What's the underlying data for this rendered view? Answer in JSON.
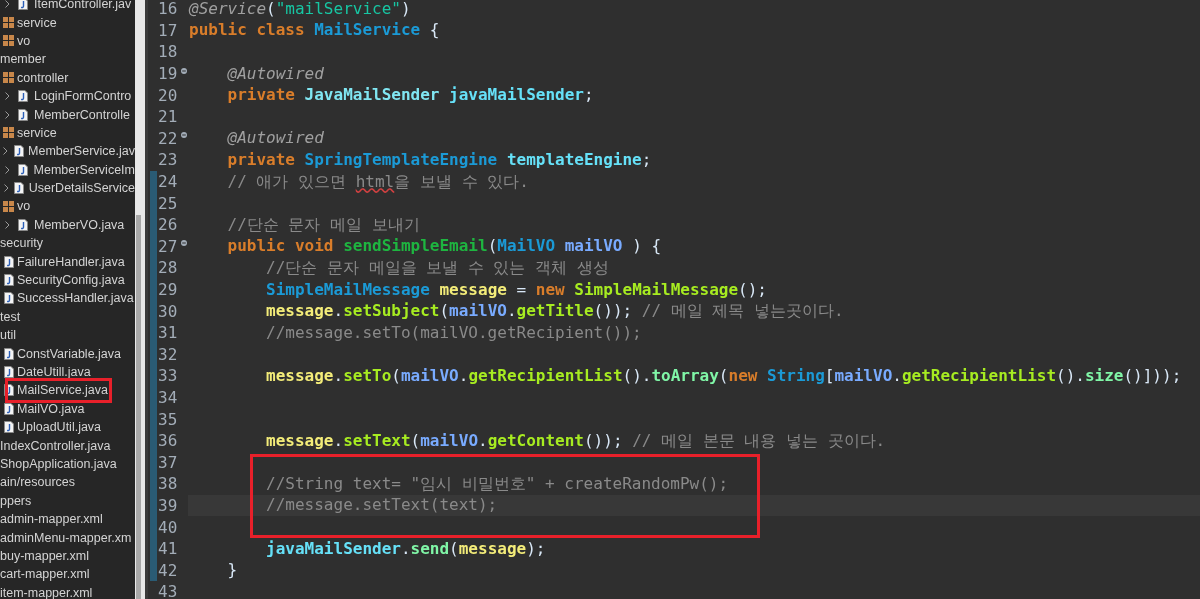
{
  "project_tree": {
    "items": [
      {
        "kind": "file",
        "text": "ItemController.jav",
        "highlighted": false
      },
      {
        "kind": "package",
        "text": "service",
        "highlighted": false
      },
      {
        "kind": "package",
        "text": "vo",
        "highlighted": false
      },
      {
        "kind": "folder",
        "text": "member",
        "highlighted": false
      },
      {
        "kind": "package",
        "text": "controller",
        "highlighted": false
      },
      {
        "kind": "file",
        "text": "LoginFormContro",
        "highlighted": false
      },
      {
        "kind": "file",
        "text": "MemberControlle",
        "highlighted": false
      },
      {
        "kind": "package",
        "text": "service",
        "highlighted": false
      },
      {
        "kind": "file",
        "text": "MemberService.jav",
        "highlighted": false
      },
      {
        "kind": "file",
        "text": "MemberServiceIm",
        "highlighted": false
      },
      {
        "kind": "file",
        "text": "UserDetailsService",
        "highlighted": false
      },
      {
        "kind": "package",
        "text": "vo",
        "highlighted": false
      },
      {
        "kind": "file",
        "text": "MemberVO.java",
        "highlighted": false
      },
      {
        "kind": "folder",
        "text": "security",
        "highlighted": false
      },
      {
        "kind": "file-plain",
        "text": "FailureHandler.java",
        "highlighted": false
      },
      {
        "kind": "file-plain",
        "text": "SecurityConfig.java",
        "highlighted": false
      },
      {
        "kind": "file-plain",
        "text": "SuccessHandler.java",
        "highlighted": false
      },
      {
        "kind": "folder",
        "text": "test",
        "highlighted": false
      },
      {
        "kind": "folder",
        "text": "util",
        "highlighted": false
      },
      {
        "kind": "file-plain",
        "text": "ConstVariable.java",
        "highlighted": false
      },
      {
        "kind": "file-plain",
        "text": "DateUtill.java",
        "highlighted": false
      },
      {
        "kind": "file-plain",
        "text": "MailService.java",
        "highlighted": true
      },
      {
        "kind": "file-plain",
        "text": "MailVO.java",
        "highlighted": false
      },
      {
        "kind": "file-plain",
        "text": "UploadUtil.java",
        "highlighted": false
      },
      {
        "kind": "folder",
        "text": "IndexController.java",
        "highlighted": false
      },
      {
        "kind": "folder",
        "text": "ShopApplication.java",
        "highlighted": false
      },
      {
        "kind": "folder",
        "text": "ain/resources",
        "highlighted": false
      },
      {
        "kind": "folder",
        "text": "ppers",
        "highlighted": false
      },
      {
        "kind": "folder",
        "text": "admin-mapper.xml",
        "highlighted": false
      },
      {
        "kind": "folder",
        "text": "adminMenu-mapper.xm",
        "highlighted": false
      },
      {
        "kind": "folder",
        "text": "buy-mapper.xml",
        "highlighted": false
      },
      {
        "kind": "folder",
        "text": "cart-mapper.xml",
        "highlighted": false
      },
      {
        "kind": "folder",
        "text": "item-mapper.xml",
        "highlighted": false
      }
    ]
  },
  "editor": {
    "lines": [
      {
        "number": "16",
        "foldable": false,
        "changed": false,
        "current": false,
        "boxed": false,
        "tokens": [
          {
            "kind": "ann",
            "text": "@Service"
          },
          {
            "kind": "plain",
            "text": "("
          },
          {
            "kind": "str",
            "text": "\"mailService\""
          },
          {
            "kind": "plain",
            "text": ")"
          }
        ]
      },
      {
        "number": "17",
        "foldable": false,
        "changed": false,
        "current": false,
        "boxed": false,
        "tokens": [
          {
            "kind": "kw",
            "text": "public class "
          },
          {
            "kind": "type",
            "text": "MailService"
          },
          {
            "kind": "plain",
            "text": " {"
          }
        ]
      },
      {
        "number": "18",
        "foldable": false,
        "changed": false,
        "current": false,
        "boxed": false
      },
      {
        "number": "19",
        "foldable": true,
        "changed": false,
        "current": false,
        "boxed": false,
        "tokens": [
          {
            "kind": "ann",
            "text": "    @Autowired"
          }
        ]
      },
      {
        "number": "20",
        "foldable": false,
        "changed": false,
        "current": false,
        "boxed": false,
        "tokens": [
          {
            "kind": "kw",
            "text": "    private "
          },
          {
            "kind": "iface",
            "text": "JavaMailSender"
          },
          {
            "kind": "field",
            "text": " javaMailSender"
          },
          {
            "kind": "plain",
            "text": ";"
          }
        ]
      },
      {
        "number": "21",
        "foldable": false,
        "changed": false,
        "current": false,
        "boxed": false
      },
      {
        "number": "22",
        "foldable": true,
        "changed": false,
        "current": false,
        "boxed": false,
        "tokens": [
          {
            "kind": "ann",
            "text": "    @Autowired"
          }
        ]
      },
      {
        "number": "23",
        "foldable": false,
        "changed": false,
        "current": false,
        "boxed": false,
        "tokens": [
          {
            "kind": "kw",
            "text": "    private "
          },
          {
            "kind": "type",
            "text": "SpringTemplateEngine"
          },
          {
            "kind": "field",
            "text": " templateEngine"
          },
          {
            "kind": "plain",
            "text": ";"
          }
        ]
      },
      {
        "number": "24",
        "foldable": false,
        "changed": true,
        "current": false,
        "boxed": false,
        "tokens": [
          {
            "kind": "cmt",
            "text": "    // 애가 있으면 "
          },
          {
            "kind": "typo",
            "text": "html"
          },
          {
            "kind": "cmt",
            "text": "을 보낼 수 있다."
          }
        ]
      },
      {
        "number": "25",
        "foldable": false,
        "changed": true,
        "current": false,
        "boxed": false
      },
      {
        "number": "26",
        "foldable": false,
        "changed": true,
        "current": false,
        "boxed": false,
        "tokens": [
          {
            "kind": "cmt",
            "text": "    //단순 문자 메일 보내기"
          }
        ]
      },
      {
        "number": "27",
        "foldable": true,
        "changed": true,
        "current": false,
        "boxed": false,
        "tokens": [
          {
            "kind": "kw",
            "text": "    public void "
          },
          {
            "kind": "decl",
            "text": "sendSimpleEmail"
          },
          {
            "kind": "plain",
            "text": "("
          },
          {
            "kind": "type",
            "text": "MailVO"
          },
          {
            "kind": "param",
            "text": " mailVO"
          },
          {
            "kind": "plain",
            "text": " ) {"
          }
        ]
      },
      {
        "number": "28",
        "foldable": false,
        "changed": true,
        "current": false,
        "boxed": false,
        "tokens": [
          {
            "kind": "cmt",
            "text": "        //단순 문자 메일을 보낼 수 있는 객체 생성"
          }
        ]
      },
      {
        "number": "29",
        "foldable": false,
        "changed": true,
        "current": false,
        "boxed": false,
        "tokens": [
          {
            "kind": "type",
            "text": "        SimpleMailMessage"
          },
          {
            "kind": "local",
            "text": " message"
          },
          {
            "kind": "plain",
            "text": " = "
          },
          {
            "kind": "kw",
            "text": "new "
          },
          {
            "kind": "call",
            "text": "SimpleMailMessage"
          },
          {
            "kind": "plain",
            "text": "();"
          }
        ]
      },
      {
        "number": "30",
        "foldable": false,
        "changed": true,
        "current": false,
        "boxed": false,
        "tokens": [
          {
            "kind": "local",
            "text": "        message"
          },
          {
            "kind": "plain",
            "text": "."
          },
          {
            "kind": "call",
            "text": "setSubject"
          },
          {
            "kind": "plain",
            "text": "("
          },
          {
            "kind": "param",
            "text": "mailVO"
          },
          {
            "kind": "plain",
            "text": "."
          },
          {
            "kind": "call",
            "text": "getTitle"
          },
          {
            "kind": "plain",
            "text": "()); "
          },
          {
            "kind": "cmt",
            "text": "// 메일 제목 넣는곳이다."
          }
        ]
      },
      {
        "number": "31",
        "foldable": false,
        "changed": true,
        "current": false,
        "boxed": false,
        "tokens": [
          {
            "kind": "cmt",
            "text": "        //message.setTo(mailVO.getRecipient());"
          }
        ]
      },
      {
        "number": "32",
        "foldable": false,
        "changed": true,
        "current": false,
        "boxed": false
      },
      {
        "number": "33",
        "foldable": false,
        "changed": true,
        "current": false,
        "boxed": false,
        "tokens": [
          {
            "kind": "local",
            "text": "        message"
          },
          {
            "kind": "plain",
            "text": "."
          },
          {
            "kind": "call",
            "text": "setTo"
          },
          {
            "kind": "plain",
            "text": "("
          },
          {
            "kind": "param",
            "text": "mailVO"
          },
          {
            "kind": "plain",
            "text": "."
          },
          {
            "kind": "call",
            "text": "getRecipientList"
          },
          {
            "kind": "plain",
            "text": "()."
          },
          {
            "kind": "call2",
            "text": "toArray"
          },
          {
            "kind": "plain",
            "text": "("
          },
          {
            "kind": "kw",
            "text": "new "
          },
          {
            "kind": "type",
            "text": "String"
          },
          {
            "kind": "plain",
            "text": "["
          },
          {
            "kind": "param",
            "text": "mailVO"
          },
          {
            "kind": "plain",
            "text": "."
          },
          {
            "kind": "call",
            "text": "getRecipientList"
          },
          {
            "kind": "plain",
            "text": "()."
          },
          {
            "kind": "call2",
            "text": "size"
          },
          {
            "kind": "plain",
            "text": "()]));"
          }
        ]
      },
      {
        "number": "34",
        "foldable": false,
        "changed": true,
        "current": false,
        "boxed": false
      },
      {
        "number": "35",
        "foldable": false,
        "changed": true,
        "current": false,
        "boxed": false
      },
      {
        "number": "36",
        "foldable": false,
        "changed": true,
        "current": false,
        "boxed": false,
        "tokens": [
          {
            "kind": "local",
            "text": "        message"
          },
          {
            "kind": "plain",
            "text": "."
          },
          {
            "kind": "call",
            "text": "setText"
          },
          {
            "kind": "plain",
            "text": "("
          },
          {
            "kind": "param",
            "text": "mailVO"
          },
          {
            "kind": "plain",
            "text": "."
          },
          {
            "kind": "call",
            "text": "getContent"
          },
          {
            "kind": "plain",
            "text": "()); "
          },
          {
            "kind": "cmt",
            "text": "// 메일 본문 내용 넣는 곳이다."
          }
        ]
      },
      {
        "number": "37",
        "foldable": false,
        "changed": true,
        "current": false,
        "boxed": true
      },
      {
        "number": "38",
        "foldable": false,
        "changed": true,
        "current": false,
        "boxed": true,
        "tokens": [
          {
            "kind": "cmt",
            "text": "        //String text= \"임시 비밀번호\" + createRandomPw();"
          }
        ]
      },
      {
        "number": "39",
        "foldable": false,
        "changed": true,
        "current": true,
        "boxed": true,
        "tokens": [
          {
            "kind": "cmt",
            "text": "        //message.setText(text);"
          }
        ]
      },
      {
        "number": "40",
        "foldable": false,
        "changed": true,
        "current": false,
        "boxed": true
      },
      {
        "number": "41",
        "foldable": false,
        "changed": true,
        "current": false,
        "boxed": false,
        "tokens": [
          {
            "kind": "field",
            "text": "        javaMailSender"
          },
          {
            "kind": "plain",
            "text": "."
          },
          {
            "kind": "call2",
            "text": "send"
          },
          {
            "kind": "plain",
            "text": "("
          },
          {
            "kind": "local",
            "text": "message"
          },
          {
            "kind": "plain",
            "text": ");"
          }
        ]
      },
      {
        "number": "42",
        "foldable": false,
        "changed": true,
        "current": false,
        "boxed": false,
        "tokens": [
          {
            "kind": "plain",
            "text": "    }"
          }
        ]
      },
      {
        "number": "43",
        "foldable": false,
        "changed": false,
        "current": false,
        "boxed": false
      }
    ]
  }
}
